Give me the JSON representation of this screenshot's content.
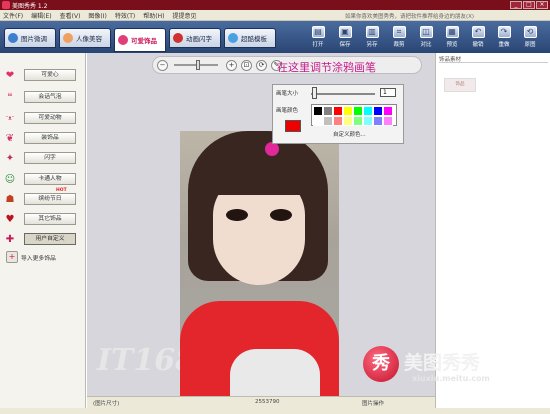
{
  "titlebar": {
    "title": "美图秀秀 1.2",
    "min": "_",
    "max": "□",
    "close": "×"
  },
  "menu": {
    "items": [
      "文件(F)",
      "编辑(E)",
      "查看(V)",
      "图像(I)",
      "特效(T)",
      "帮助(H)",
      "提提意见"
    ],
    "notice": "如果你喜欢美图秀秀，请把软件推荐给身边的朋友(X)"
  },
  "tabs": [
    {
      "label": "图片微调",
      "color": "#3d7fcf"
    },
    {
      "label": "人像美容",
      "color": "#f0a060"
    },
    {
      "label": "可爱饰品",
      "color": "#e0407a"
    },
    {
      "label": "动画闪字",
      "color": "#d03030"
    },
    {
      "label": "超酷模板",
      "color": "#4aa0e0"
    }
  ],
  "tools": [
    {
      "label": "打开",
      "glyph": "▤"
    },
    {
      "label": "保存",
      "glyph": "▣"
    },
    {
      "label": "另存",
      "glyph": "▥"
    },
    {
      "label": "裁剪",
      "glyph": "⌗"
    },
    {
      "label": "对比",
      "glyph": "◫"
    },
    {
      "label": "预览",
      "glyph": "▦"
    },
    {
      "label": "撤销",
      "glyph": "↶"
    },
    {
      "label": "重做",
      "glyph": "↷"
    },
    {
      "label": "原图",
      "glyph": "⟲"
    }
  ],
  "categories": [
    {
      "label": "可爱心",
      "glyph": "❤",
      "color": "#e0306a"
    },
    {
      "label": "会话气泡",
      "glyph": "❝",
      "color": "#e07090"
    },
    {
      "label": "可爱动物",
      "glyph": "ᵔᴥᵔ",
      "color": "#d04070"
    },
    {
      "label": "装饰品",
      "glyph": "❦",
      "color": "#d0306a"
    },
    {
      "label": "闪字",
      "glyph": "✦",
      "color": "#c03060"
    },
    {
      "label": "卡通人物",
      "glyph": "☺",
      "color": "#2c8a3c"
    },
    {
      "label": "缤纷节日",
      "glyph": "☗",
      "color": "#c04020",
      "hot": "HOT"
    },
    {
      "label": "其它饰品",
      "glyph": "♥",
      "color": "#c01020"
    },
    {
      "label": "用户自定义",
      "glyph": "✚",
      "color": "#c81a5a"
    }
  ],
  "import_label": "导入更多饰品",
  "zoom": {
    "zoom_out": "−",
    "zoom_in": "+",
    "fit": "⊡",
    "rotate": "⟳",
    "brush": "✎",
    "callout": "在这里调节涂鸦画笔"
  },
  "brush": {
    "size_label": "画笔大小",
    "size_value": "1",
    "color_label": "画笔颜色",
    "custom_label": "自定义颜色...",
    "current_color": "#ee0000",
    "palette": [
      "#000000",
      "#808080",
      "#ff0000",
      "#ffff00",
      "#00ff00",
      "#00ffff",
      "#0000ff",
      "#ff00ff",
      "#ffffff",
      "#c0c0c0",
      "#ff8080",
      "#ffff80",
      "#80ff80",
      "#80ffff",
      "#8080ff",
      "#ff80ff"
    ]
  },
  "watermark": "IT168",
  "right_panel": {
    "header": "饰品素材",
    "thumb_label": "饰品"
  },
  "brand": {
    "logo": "秀",
    "name": "美图秀秀",
    "url": "xiuxiu.meitu.com"
  },
  "status": {
    "size": "(图片尺寸)",
    "count": "2553790",
    "action": "图片操作"
  }
}
